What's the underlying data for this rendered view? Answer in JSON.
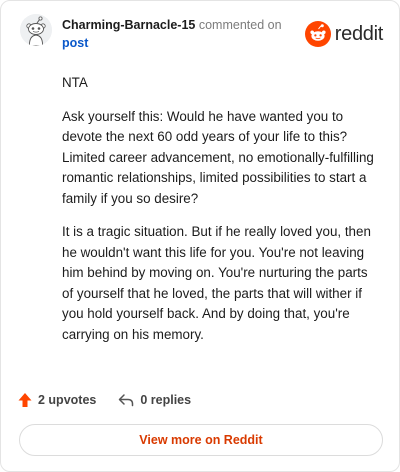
{
  "header": {
    "username": "Charming-Barnacle-15",
    "action_text": "commented on",
    "post_link": "post",
    "brand_name": "reddit",
    "avatar_icon": "snoo-avatar-icon",
    "brand_icon": "reddit-logo-icon"
  },
  "comment": {
    "paragraphs": [
      "NTA",
      "Ask yourself this: Would he have wanted you to devote the next 60 odd years of your life to this? Limited career advancement, no emotionally-fulfilling romantic relationships, limited possibilities to start a family if you so desire?",
      "It is a tragic situation. But if he really loved you, then he wouldn't want this life for you. You're not leaving him behind by moving on. You're nurturing the parts of yourself that he loved, the parts that will wither if you hold yourself back. And by doing that, you're carrying on his memory."
    ]
  },
  "footer": {
    "upvotes": "2 upvotes",
    "replies": "0 replies",
    "view_more": "View more on Reddit",
    "upvote_icon": "upvote-arrow-icon",
    "reply_icon": "reply-arrow-icon"
  },
  "colors": {
    "brand": "#ff4500",
    "link": "#0a58ca",
    "cta": "#d93a00",
    "muted": "#7c7c7c"
  }
}
